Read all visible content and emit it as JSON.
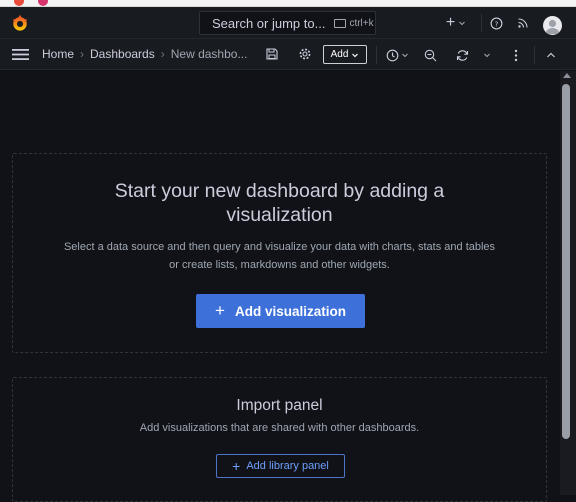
{
  "topbar": {
    "search_placeholder": "Search or jump to...",
    "search_shortcut": "ctrl+k",
    "new_label": "+"
  },
  "navbar": {
    "breadcrumbs": [
      {
        "label": "Home"
      },
      {
        "label": "Dashboards"
      },
      {
        "label": "New dashbo..."
      }
    ],
    "add_label": "Add"
  },
  "empty_state": {
    "title": "Start your new dashboard by adding a visualization",
    "description": "Select a data source and then query and visualize your data with charts, stats and tables or create lists, markdowns and other widgets.",
    "button_label": "Add visualization",
    "button_icon": "+"
  },
  "import_panel": {
    "title": "Import panel",
    "description": "Add visualizations that are shared with other dashboards.",
    "button_label": "Add library panel",
    "button_icon": "+"
  },
  "colors": {
    "background": "#111217",
    "topbar": "#181b1f",
    "primary_button": "#3d71d9",
    "link_blue": "#6e9fff",
    "brand_orange": "#f46800"
  },
  "icons": [
    "grafana-logo-icon",
    "search-icon",
    "keyboard-icon",
    "plus-icon",
    "chevron-down-icon",
    "help-icon",
    "rss-icon",
    "user-avatar-icon",
    "menu-icon",
    "save-icon",
    "gear-icon",
    "clock-icon",
    "zoom-out-icon",
    "refresh-icon",
    "kebab-icon",
    "collapse-icon"
  ]
}
